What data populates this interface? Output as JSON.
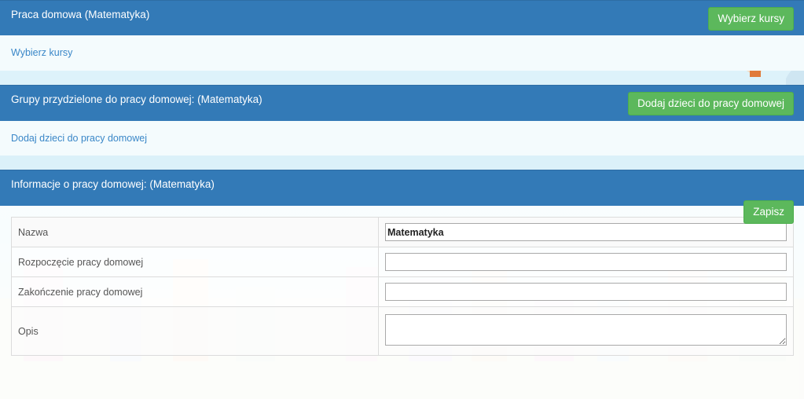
{
  "courses_panel": {
    "title": "Praca domowa (Matematyka)",
    "button_label": "Wybierz kursy",
    "link_label": "Wybierz kursy"
  },
  "groups_panel": {
    "title": "Grupy przydzielone do pracy domowej: (Matematyka)",
    "button_label": "Dodaj dzieci do pracy domowej",
    "link_label": "Dodaj dzieci do pracy domowej"
  },
  "info_panel": {
    "title": "Informacje o pracy domowej: (Matematyka)",
    "rows": [
      {
        "label": "Nazwa",
        "value": "Matematyka"
      },
      {
        "label": "Rozpoczęcie pracy domowej",
        "value": ""
      },
      {
        "label": "Zakończenie pracy domowej",
        "value": ""
      },
      {
        "label": "Opis",
        "value": ""
      }
    ],
    "save_label": "Zapisz"
  },
  "colors": {
    "header_blue": "#337ab7",
    "button_green": "#5cb85c",
    "link_blue": "#3a87c8"
  }
}
